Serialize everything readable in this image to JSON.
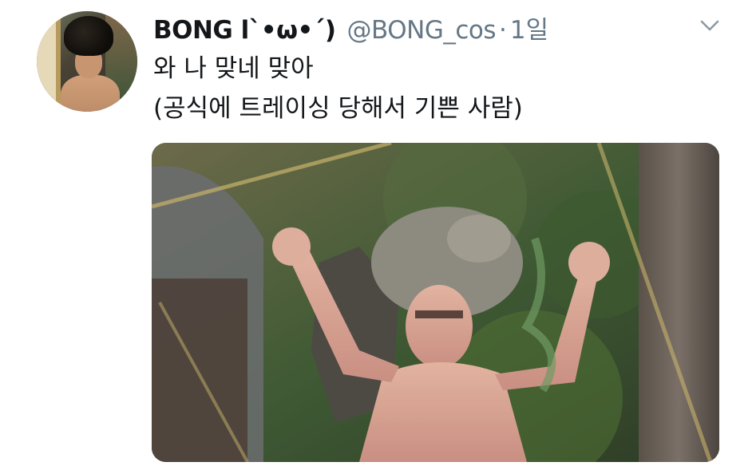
{
  "tweet": {
    "author_name": "BONG l`•ω•´)",
    "author_handle": "@BONG_cos",
    "separator": "·",
    "timestamp": "1일",
    "text_line_1": "와 나 맞네 맞아",
    "text_line_2": "(공식에 트레이싱 당해서 기쁜 사람)",
    "menu_icon": "chevron-down-icon",
    "avatar_icon": "avatar",
    "media_icon": "photo"
  },
  "colors": {
    "text": "#14171a",
    "secondary": "#657786",
    "background": "#ffffff"
  }
}
